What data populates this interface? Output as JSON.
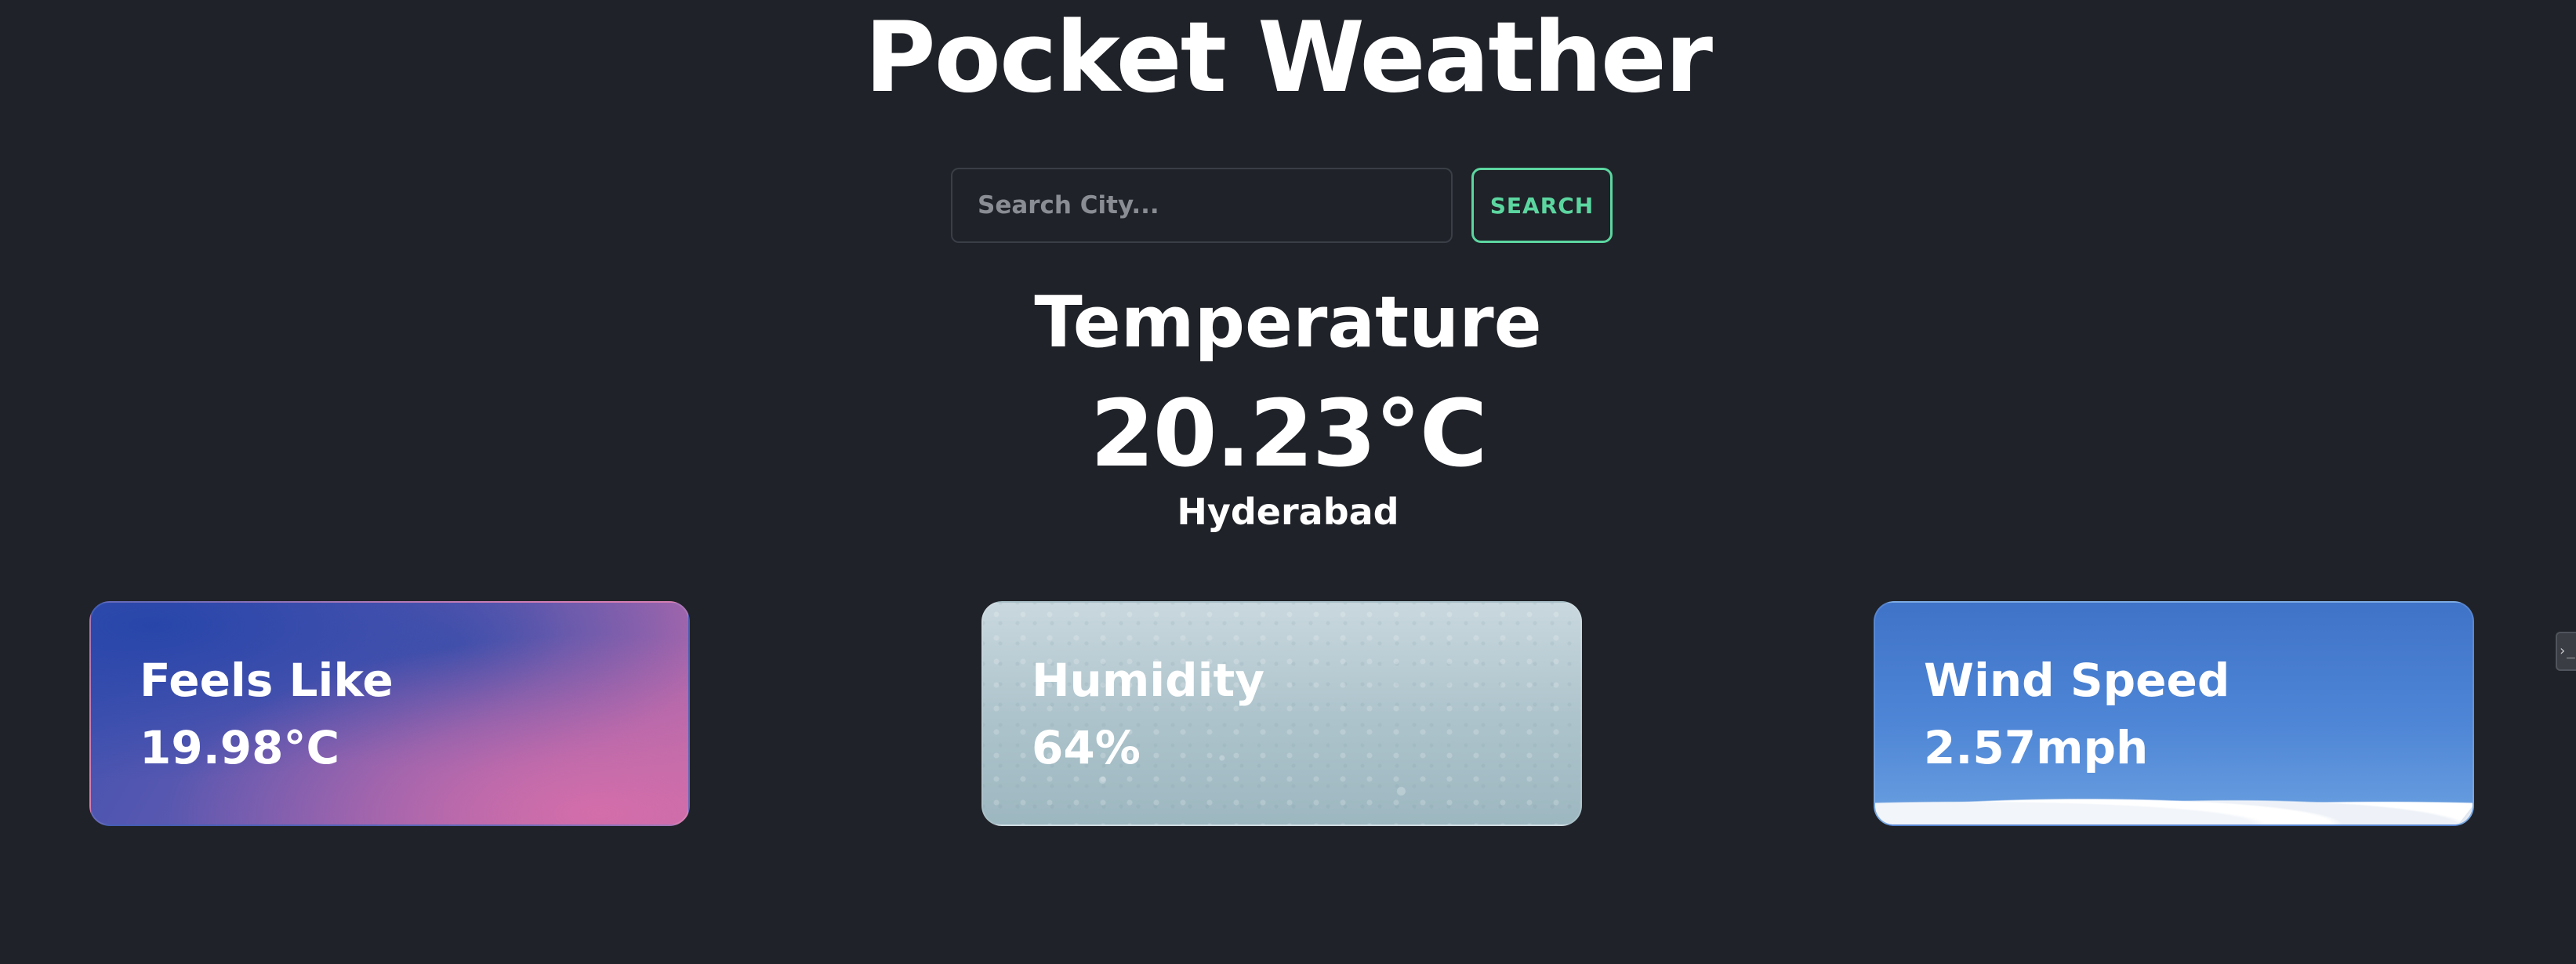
{
  "app": {
    "title": "Pocket Weather"
  },
  "search": {
    "placeholder": "Search City...",
    "value": "",
    "button_label": "SEARCH"
  },
  "current": {
    "heading": "Temperature",
    "temperature": "20.23°C",
    "city": "Hyderabad"
  },
  "cards": [
    {
      "label": "Feels Like",
      "value": "19.98°C"
    },
    {
      "label": "Humidity",
      "value": "64%"
    },
    {
      "label": "Wind Speed",
      "value": "2.57mph"
    }
  ],
  "side_tab": {
    "glyph": "›_"
  },
  "colors": {
    "background": "#1f2228",
    "accent": "#5cd6a0",
    "text": "#ffffff"
  }
}
